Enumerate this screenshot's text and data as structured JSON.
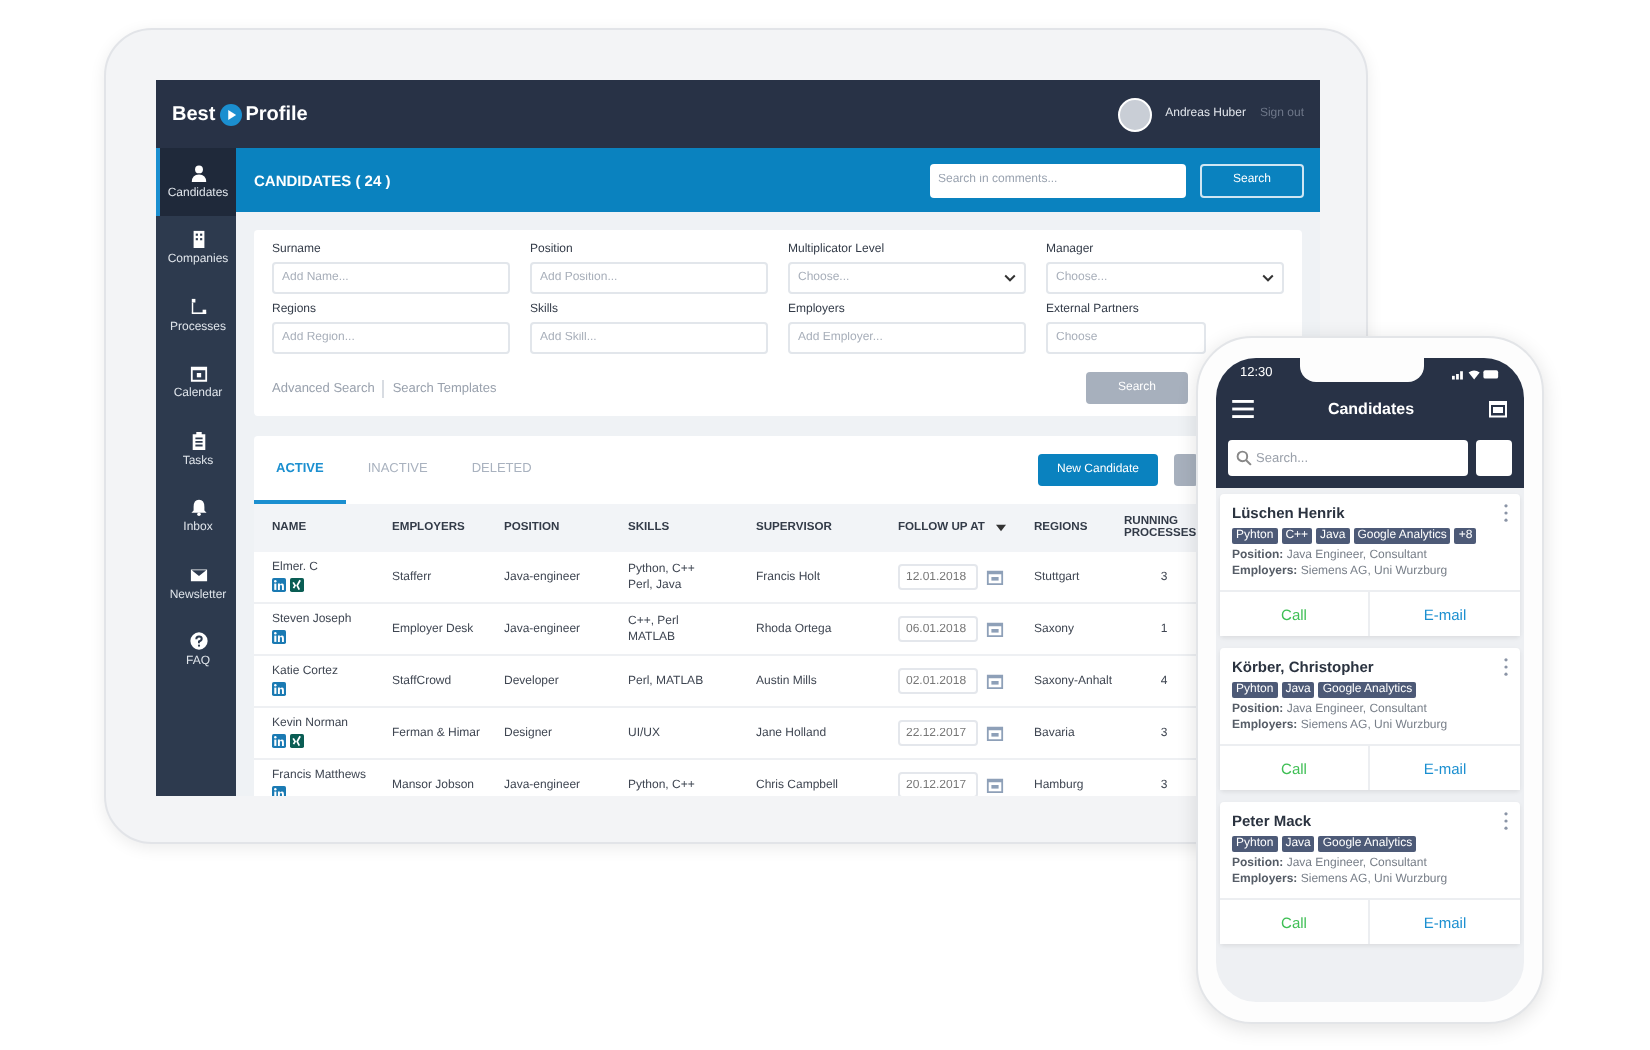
{
  "tablet": {
    "logo": {
      "left": "Best",
      "right": "Profile"
    },
    "user": {
      "name": "Andreas Huber",
      "sign_out": "Sign out"
    },
    "sidebar": {
      "items": [
        {
          "label": "Candidates",
          "kind": "person",
          "selected": true
        },
        {
          "label": "Companies",
          "kind": "building",
          "selected": false
        },
        {
          "label": "Processes",
          "kind": "flow",
          "selected": false
        },
        {
          "label": "Calendar",
          "kind": "calendar",
          "selected": false
        },
        {
          "label": "Tasks",
          "kind": "clipboard",
          "selected": false
        },
        {
          "label": "Inbox",
          "kind": "bell",
          "selected": false
        },
        {
          "label": "Newsletter",
          "kind": "mail",
          "selected": false
        },
        {
          "label": "FAQ",
          "kind": "help",
          "selected": false
        }
      ]
    },
    "page_title": "CANDIDATES ( 24 )",
    "comment_search": {
      "placeholder": "Search in comments..."
    },
    "comment_search_button": "Search",
    "filters": [
      {
        "label": "Surname",
        "placeholder": "Add Name...",
        "kind": "text"
      },
      {
        "label": "Position",
        "placeholder": "Add Position...",
        "kind": "text"
      },
      {
        "label": "Multiplicator Level",
        "placeholder": "Choose...",
        "kind": "select"
      },
      {
        "label": "Manager",
        "placeholder": "Choose...",
        "kind": "select"
      },
      {
        "label": "Regions",
        "placeholder": "Add Region...",
        "kind": "text"
      },
      {
        "label": "Skills",
        "placeholder": "Add Skill...",
        "kind": "text"
      },
      {
        "label": "Employers",
        "placeholder": "Add Employer...",
        "kind": "text"
      },
      {
        "label": "External Partners",
        "placeholder": "Choose",
        "kind": "text"
      }
    ],
    "filter_links": [
      "Advanced Search",
      "Search Templates"
    ],
    "filter_search_button": "Search",
    "tabs": [
      {
        "label": "ACTIVE",
        "selected": true
      },
      {
        "label": "INACTIVE",
        "selected": false
      },
      {
        "label": "DELETED",
        "selected": false
      }
    ],
    "new_button": "New Candidate",
    "table": {
      "columns": [
        "NAME",
        "EMPLOYERS",
        "POSITION",
        "SKILLS",
        "SUPERVISOR",
        "FOLLOW UP AT",
        "REGIONS",
        "RUNNING PROCESSES"
      ],
      "rows": [
        {
          "name": "Elmer. C",
          "profiles": [
            {
              "kind": "linkedin"
            },
            {
              "kind": "xing"
            }
          ],
          "employer": "Stafferr",
          "position": "Java-engineer",
          "skills": [
            "Python, C++",
            "Perl, Java"
          ],
          "supervisor": "Francis Holt",
          "follow_up": "12.01.2018",
          "region": "Stuttgart",
          "processes": "3"
        },
        {
          "name": "Steven Joseph",
          "profiles": [
            {
              "kind": "linkedin"
            }
          ],
          "employer": "Employer Desk",
          "position": "Java-engineer",
          "skills": [
            "C++, Perl",
            "MATLAB"
          ],
          "supervisor": "Rhoda Ortega",
          "follow_up": "06.01.2018",
          "region": "Saxony",
          "processes": "1"
        },
        {
          "name": "Katie Cortez",
          "profiles": [
            {
              "kind": "linkedin"
            }
          ],
          "employer": "StaffCrowd",
          "position": "Developer",
          "skills": [
            "Perl, MATLAB"
          ],
          "supervisor": "Austin Mills",
          "follow_up": "02.01.2018",
          "region": "Saxony-Anhalt",
          "processes": "4"
        },
        {
          "name": "Kevin Norman",
          "profiles": [
            {
              "kind": "linkedin"
            },
            {
              "kind": "xing"
            }
          ],
          "employer": "Ferman & Himar",
          "position": "Designer",
          "skills": [
            "UI/UX"
          ],
          "supervisor": "Jane Holland",
          "follow_up": "22.12.2017",
          "region": "Bavaria",
          "processes": "3"
        },
        {
          "name": "Francis Matthews",
          "profiles": [
            {
              "kind": "linkedin"
            }
          ],
          "employer": "Mansor Jobson",
          "position": "Java-engineer",
          "skills": [
            "Python, C++"
          ],
          "supervisor": "Chris Campbell",
          "follow_up": "20.12.2017",
          "region": "Hamburg",
          "processes": "3"
        }
      ]
    }
  },
  "phone": {
    "time": "12:30",
    "title": "Candidates",
    "search": {
      "placeholder": "Search..."
    },
    "cards": [
      {
        "name": "Lüschen Henrik",
        "tags": [
          "Pyhton",
          "C++",
          "Java",
          "Google Analytics",
          "+8"
        ],
        "position": "**Position:** Java Engineer, Consultant",
        "employers": "**Employers:** Siemens AG, Uni Wurzburg",
        "call": "Call",
        "email": "E-mail"
      },
      {
        "name": "Körber, Christopher",
        "tags": [
          "Pyhton",
          "Java",
          "Google Analytics"
        ],
        "position": "**Position:** Java Engineer, Consultant",
        "employers": "**Employers:** Siemens AG, Uni Wurzburg",
        "call": "Call",
        "email": "E-mail"
      },
      {
        "name": "Peter Mack",
        "tags": [
          "Pyhton",
          "Java",
          "Google Analytics"
        ],
        "position": "**Position:** Java Engineer, Consultant",
        "employers": "**Employers:** Siemens AG, Uni Wurzburg",
        "call": "Call",
        "email": "E-mail"
      }
    ]
  }
}
